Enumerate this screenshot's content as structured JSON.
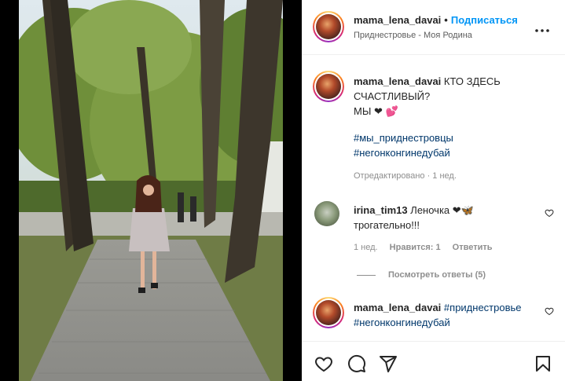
{
  "post": {
    "username": "mama_lena_davai",
    "separator": "•",
    "follow_label": "Подписаться",
    "location": "Приднестровье - Моя Родина",
    "more_label": "•••"
  },
  "caption": {
    "username": "mama_lena_davai",
    "text": "КТО ЗДЕСЬ СЧАСТЛИВЫЙ?",
    "line2": "МЫ ❤ 💕",
    "hashtags": [
      "#мы_приднестровцы",
      "#негонконгинедубай"
    ],
    "meta": "Отредактировано · 1 нед."
  },
  "comments": [
    {
      "username": "irina_tim13",
      "text": "Леночка ❤🦋 трогательно!!!",
      "time": "1 нед.",
      "likes": "Нравится: 1",
      "reply_label": "Ответить",
      "view_replies": "Посмотреть ответы (5)"
    },
    {
      "username": "mama_lena_davai",
      "hashtags": [
        "#приднестровье",
        "#негонконгинедубай"
      ]
    }
  ],
  "icons": {
    "like": "heart-icon",
    "comment": "comment-icon",
    "share": "share-icon",
    "save": "bookmark-icon",
    "more": "more-icon"
  },
  "colors": {
    "link_blue": "#0095f6",
    "hashtag": "#00376b",
    "muted": "#8e8e8e"
  }
}
